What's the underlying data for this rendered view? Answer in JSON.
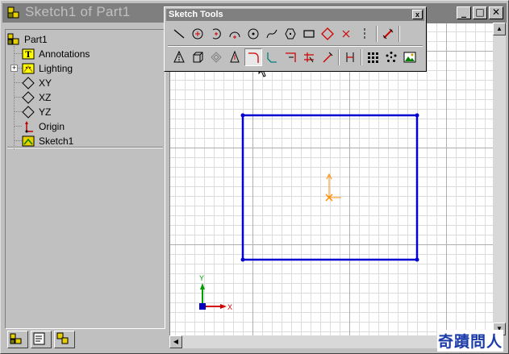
{
  "window": {
    "title": "Sketch1 of Part1",
    "minimize_glyph": "_",
    "maximize_glyph": "□",
    "close_glyph": "✕"
  },
  "feature_tree": {
    "items": [
      {
        "label": "Part1",
        "icon": "part-icon"
      },
      {
        "label": "Annotations",
        "icon": "annotations-icon"
      },
      {
        "label": "Lighting",
        "icon": "lighting-icon",
        "expandable": true
      },
      {
        "label": "XY",
        "icon": "plane-icon"
      },
      {
        "label": "XZ",
        "icon": "plane-icon"
      },
      {
        "label": "YZ",
        "icon": "plane-icon"
      },
      {
        "label": "Origin",
        "icon": "origin-icon"
      },
      {
        "label": "Sketch1",
        "icon": "sketch-icon"
      }
    ],
    "expand_glyph": "+",
    "tabs": [
      "feature-manager-tab",
      "property-manager-tab",
      "configuration-manager-tab"
    ]
  },
  "sketch_toolbar": {
    "title": "Sketch Tools",
    "close_glyph": "x",
    "row1": [
      "line-icon",
      "circle-icon",
      "centerpoint-arc-icon",
      "tangent-arc-icon",
      "3point-arc-icon",
      "spline-icon",
      "polygon-icon",
      "rectangle-icon",
      "parallelogram-icon",
      "point-icon",
      "centerline-icon",
      "dimension-icon"
    ],
    "row2": [
      "mirror-icon",
      "convert-entities-icon",
      "offset-icon",
      "offset-entities-icon",
      "fillet-icon",
      "chamfer-icon",
      "extend-icon",
      "trim-icon",
      "split-icon",
      "construction-geometry-icon",
      "linear-pattern-icon",
      "circular-pattern-icon",
      "sketch-picture-icon"
    ],
    "pressed_tool": "fillet-icon"
  },
  "graphics": {
    "axis_x_label": "X",
    "axis_y_label": "Y",
    "sketch_color": "#0000d0",
    "origin_color": "#ff8c00"
  },
  "scrollbar": {
    "up_glyph": "▲",
    "down_glyph": "▼",
    "left_glyph": "◀",
    "right_glyph": "▶"
  },
  "watermark": "奇蹟問人"
}
